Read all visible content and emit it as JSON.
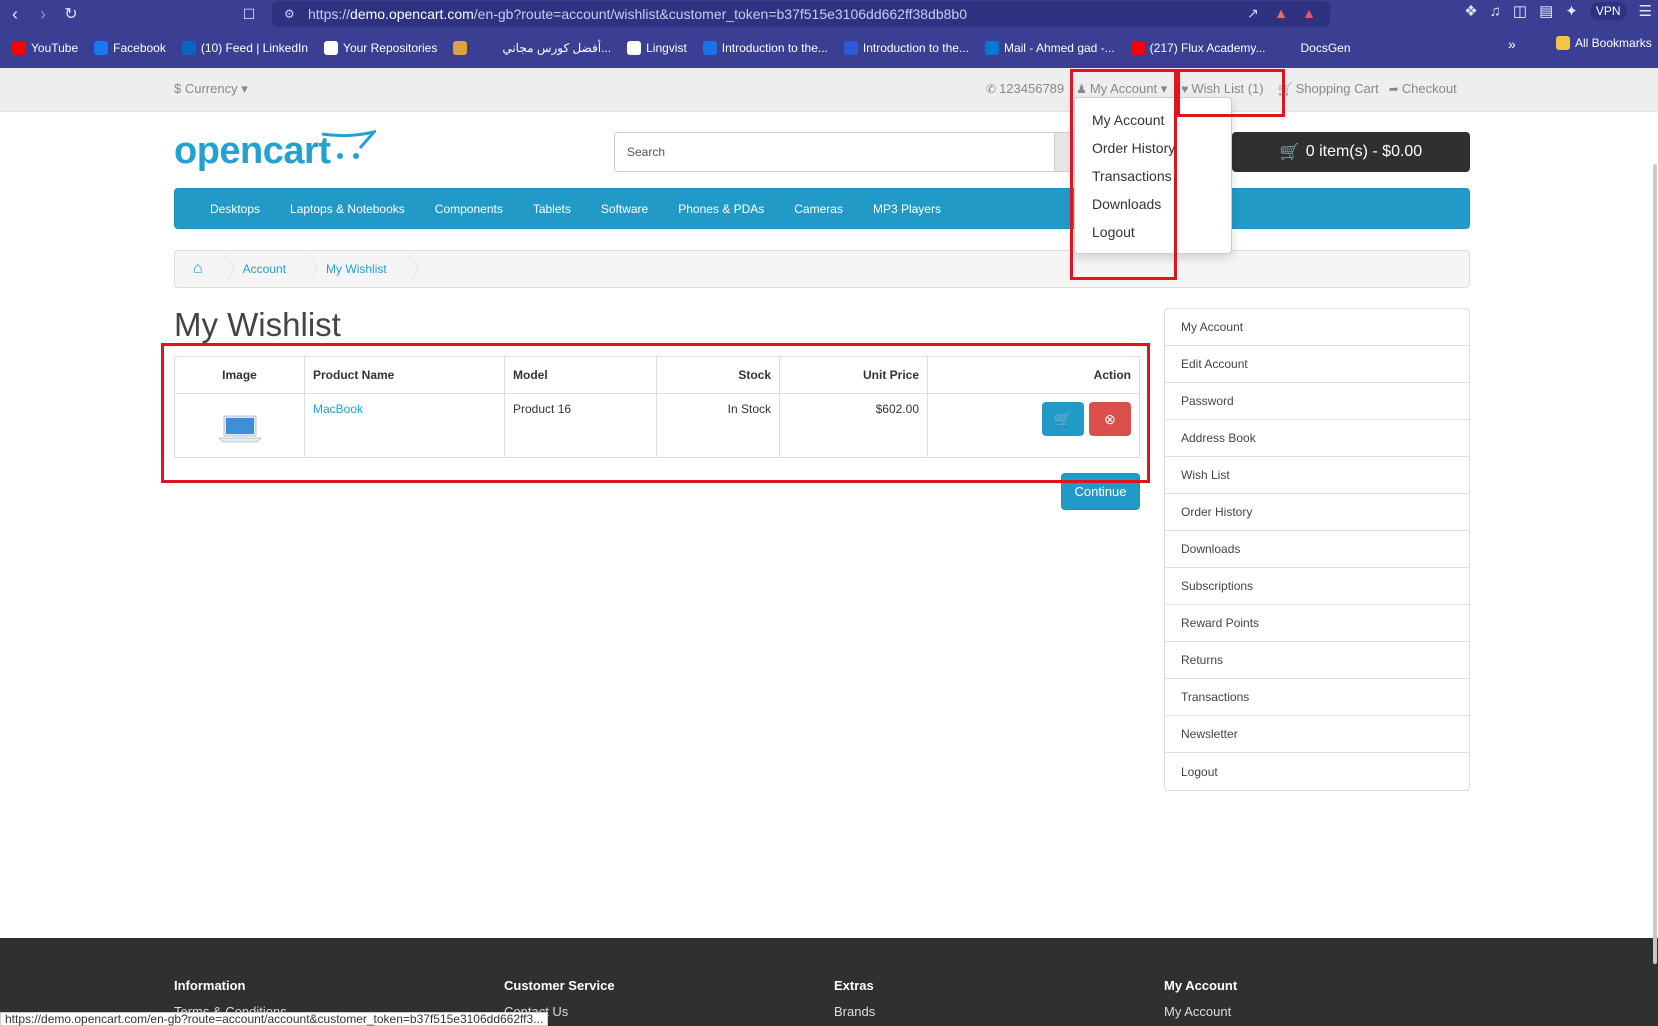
{
  "browser": {
    "url_prefix": "https://",
    "url_host": "demo.opencart.com",
    "url_path": "/en-gb?route=account/wishlist&customer_token=b37f515e3106dd662ff38db8b0",
    "vpn_label": "VPN",
    "bookmarks": [
      {
        "label": "YouTube",
        "color": "#ff0000"
      },
      {
        "label": "Facebook",
        "color": "#1877f2"
      },
      {
        "label": "(10) Feed | LinkedIn",
        "color": "#0a66c2"
      },
      {
        "label": "Your Repositories",
        "color": "#ffffff"
      },
      {
        "label": "",
        "color": "#e0a040"
      },
      {
        "label": "أفضل كورس مجاني...",
        "color": "#3a3f93"
      },
      {
        "label": "Lingvist",
        "color": "#ffffff"
      },
      {
        "label": "Introduction to the...",
        "color": "#1a73e8"
      },
      {
        "label": "Introduction to the...",
        "color": "#2d5bd6"
      },
      {
        "label": "Mail - Ahmed gad -...",
        "color": "#0078d4"
      },
      {
        "label": "(217) Flux Academy...",
        "color": "#ff0000"
      },
      {
        "label": "DocsGen",
        "color": "#3a3f93"
      }
    ],
    "bookmarks_more": "»",
    "all_bookmarks": "All Bookmarks",
    "status_url": "https://demo.opencart.com/en-gb?route=account/account&customer_token=b37f515e3106dd662ff3..."
  },
  "topbar": {
    "currency": "$ Currency",
    "phone": "123456789",
    "my_account": "My Account",
    "wish_list": "Wish List (1)",
    "shopping_cart": "Shopping Cart",
    "checkout": "Checkout"
  },
  "header": {
    "logo": "opencart",
    "search_placeholder": "Search",
    "cart": "0 item(s) - $0.00"
  },
  "menu": [
    "Desktops",
    "Laptops & Notebooks",
    "Components",
    "Tablets",
    "Software",
    "Phones & PDAs",
    "Cameras",
    "MP3 Players"
  ],
  "breadcrumb": [
    "Account",
    "My Wishlist"
  ],
  "page_title": "My Wishlist",
  "table": {
    "headers": [
      "Image",
      "Product Name",
      "Model",
      "Stock",
      "Unit Price",
      "Action"
    ],
    "rows": [
      {
        "name": "MacBook",
        "model": "Product 16",
        "stock": "In Stock",
        "price": "$602.00"
      }
    ]
  },
  "continue_label": "Continue",
  "sidebar": [
    "My Account",
    "Edit Account",
    "Password",
    "Address Book",
    "Wish List",
    "Order History",
    "Downloads",
    "Subscriptions",
    "Reward Points",
    "Returns",
    "Transactions",
    "Newsletter",
    "Logout"
  ],
  "dropdown": [
    "My Account",
    "Order History",
    "Transactions",
    "Downloads",
    "Logout"
  ],
  "footer": {
    "columns": [
      "Information",
      "Customer Service",
      "Extras",
      "My Account"
    ],
    "links": [
      "Terms & Conditions",
      "Contact Us",
      "Brands",
      "My Account"
    ]
  },
  "colors": {
    "accent": "#229ac8",
    "highlight": "#e0141e",
    "danger": "#da4f49"
  }
}
